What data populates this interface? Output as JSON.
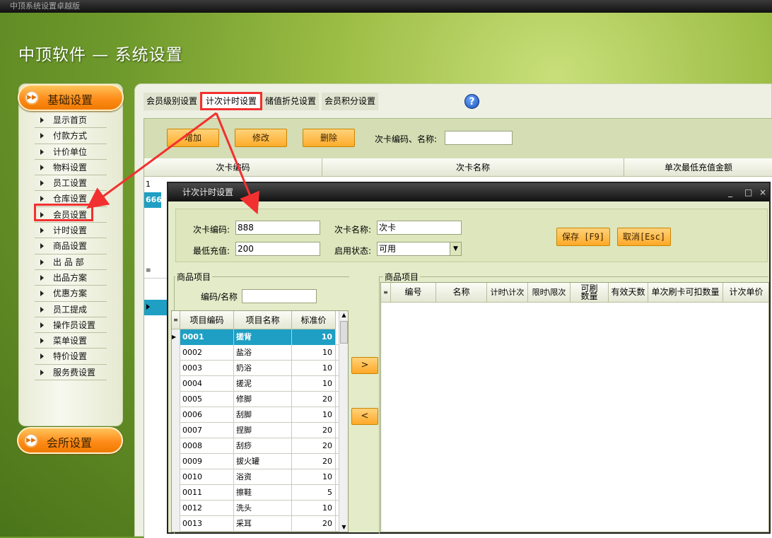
{
  "window": {
    "title": "中顶系统设置卓越版"
  },
  "app": {
    "title": "中顶软件 — 系统设置"
  },
  "sidebar": {
    "section1": "基础设置",
    "section2": "会所设置",
    "items": [
      "显示首页",
      "付款方式",
      "计价单位",
      "物料设置",
      "员工设置",
      "仓库设置",
      "会员设置",
      "计时设置",
      "商品设置",
      "出 品 部",
      "出品方案",
      "优惠方案",
      "员工提成",
      "操作员设置",
      "菜单设置",
      "特价设置",
      "服务费设置"
    ],
    "selected_index": 6
  },
  "tabs": [
    "会员级别设置",
    "计次计时设置",
    "储值折兑设置",
    "会员积分设置"
  ],
  "active_tab_index": 1,
  "toolbar": {
    "add": "增加",
    "edit": "修改",
    "delete": "删除",
    "search_label": "次卡编码、名称:",
    "search_value": ""
  },
  "main_grid": {
    "headers": [
      "次卡编码",
      "次卡名称",
      "单次最低充值金额"
    ],
    "rows": [
      {
        "code": "1"
      },
      {
        "code": "666"
      }
    ]
  },
  "dialog": {
    "title": "计次计时设置",
    "controls": [
      "_",
      "□",
      "×"
    ],
    "card_code_label": "次卡编码:",
    "card_code_value": "888",
    "card_name_label": "次卡名称:",
    "card_name_value": "次卡",
    "min_charge_label": "最低充值:",
    "min_charge_value": "200",
    "status_label": "启用状态:",
    "status_value": "可用",
    "save_button": "保存 [F9]",
    "cancel_button": "取消[Esc]",
    "left_group_title": "商品项目",
    "filter_label": "编码/名称",
    "filter_value": "",
    "left_headers": [
      "项目编码",
      "项目名称",
      "标准价"
    ],
    "left_rows": [
      {
        "code": "0001",
        "name": "搓背",
        "price": "10"
      },
      {
        "code": "0002",
        "name": "盐浴",
        "price": "10"
      },
      {
        "code": "0003",
        "name": "奶浴",
        "price": "10"
      },
      {
        "code": "0004",
        "name": "搓泥",
        "price": "10"
      },
      {
        "code": "0005",
        "name": "修脚",
        "price": "20"
      },
      {
        "code": "0006",
        "name": "刮脚",
        "price": "10"
      },
      {
        "code": "0007",
        "name": "捏脚",
        "price": "20"
      },
      {
        "code": "0008",
        "name": "刮痧",
        "price": "20"
      },
      {
        "code": "0009",
        "name": "拔火罐",
        "price": "20"
      },
      {
        "code": "0010",
        "name": "浴资",
        "price": "10"
      },
      {
        "code": "0011",
        "name": "擦鞋",
        "price": "5"
      },
      {
        "code": "0012",
        "name": "洗头",
        "price": "10"
      },
      {
        "code": "0013",
        "name": "采耳",
        "price": "20"
      }
    ],
    "right_group_title": "商品项目",
    "right_headers": [
      "编号",
      "名称",
      "计时\\计次",
      "限时\\限次",
      "可刷数量",
      "有效天数",
      "单次刷卡可扣数量",
      "计次单价"
    ],
    "move_right": ">",
    "move_left": "<"
  },
  "colors": {
    "accent_orange": "#ffac2a",
    "selection": "#1e9fc3",
    "highlight": "#f23030"
  }
}
